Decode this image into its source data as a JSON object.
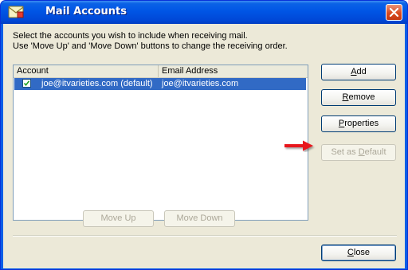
{
  "window": {
    "title": "Mail Accounts"
  },
  "instructions": {
    "line1": "Select the accounts you wish to include when receiving mail.",
    "line2": "Use 'Move Up' and 'Move Down' buttons to change the receiving order."
  },
  "list": {
    "columns": [
      "Account",
      "Email Address"
    ],
    "rows": [
      {
        "checked": true,
        "selected": true,
        "account": "joe@itvarieties.com (default)",
        "email": "joe@itvarieties.com"
      }
    ]
  },
  "buttons": {
    "add": {
      "pre": "",
      "key": "A",
      "post": "dd"
    },
    "remove": {
      "pre": "",
      "key": "R",
      "post": "emove"
    },
    "properties": {
      "pre": "",
      "key": "P",
      "post": "roperties"
    },
    "set_default": {
      "pre": "Set as ",
      "key": "D",
      "post": "efault"
    },
    "move_up": "Move Up",
    "move_down": "Move Down",
    "close": {
      "pre": "",
      "key": "C",
      "post": "lose"
    }
  },
  "annotation": {
    "arrow_color": "#e8141a"
  },
  "colors": {
    "selection": "#316ac5",
    "titlebar": "#0055e5",
    "dialog_bg": "#ece9d8"
  },
  "icons": [
    "mail-accounts-icon",
    "close-icon",
    "checkbox-checked-icon",
    "red-arrow-icon"
  ]
}
